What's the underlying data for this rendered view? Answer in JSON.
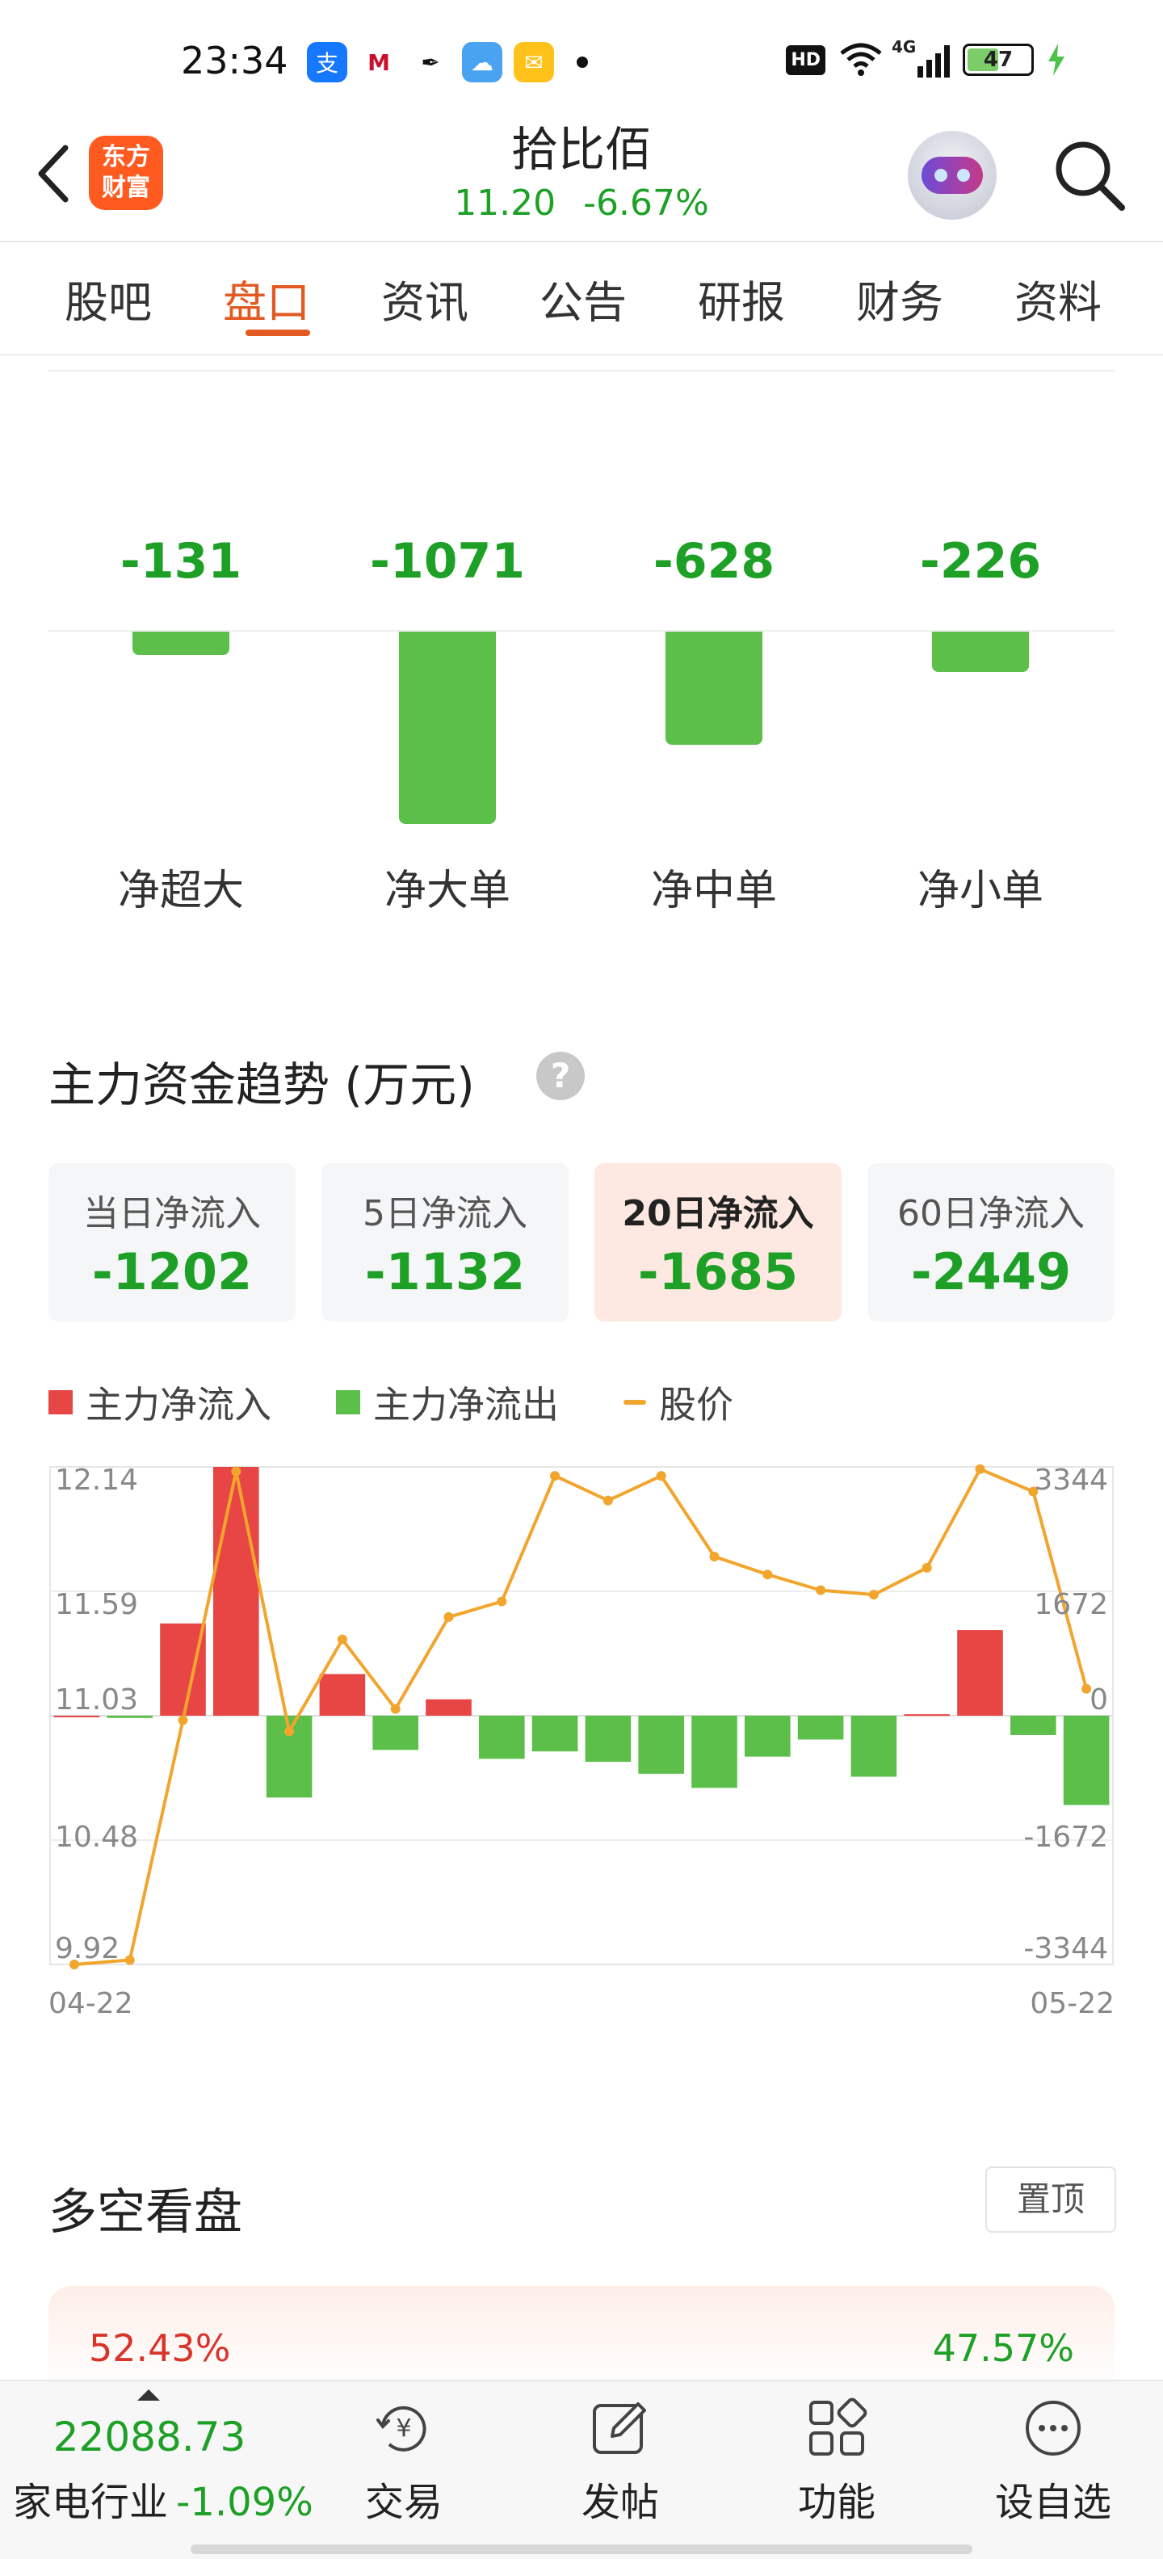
{
  "status_bar": {
    "time": "23:34",
    "network": "4G",
    "hd": "HD",
    "battery": "47"
  },
  "header": {
    "logo_line1": "东方",
    "logo_line2": "财富",
    "stock_name": "拾比佰",
    "price": "11.20",
    "change_pct": "-6.67%"
  },
  "tabs": [
    {
      "label": "股吧",
      "active": false
    },
    {
      "label": "盘口",
      "active": true
    },
    {
      "label": "资讯",
      "active": false
    },
    {
      "label": "公告",
      "active": false
    },
    {
      "label": "研报",
      "active": false
    },
    {
      "label": "财务",
      "active": false
    },
    {
      "label": "资料",
      "active": false
    }
  ],
  "net_flow": [
    {
      "label": "净超大",
      "value": -131
    },
    {
      "label": "净大单",
      "value": -1071
    },
    {
      "label": "净中单",
      "value": -628
    },
    {
      "label": "净小单",
      "value": -226
    }
  ],
  "trend": {
    "title": "主力资金趋势 (万元)",
    "help": "?",
    "cards": [
      {
        "label": "当日净流入",
        "value": "-1202",
        "active": false
      },
      {
        "label": "5日净流入",
        "value": "-1132",
        "active": false
      },
      {
        "label": "20日净流入",
        "value": "-1685",
        "active": true
      },
      {
        "label": "60日净流入",
        "value": "-2449",
        "active": false
      }
    ],
    "legend": {
      "inflow": "主力净流入",
      "outflow": "主力净流出",
      "price": "股价"
    }
  },
  "colors": {
    "inflow": "#e84545",
    "outflow": "#5bbf4a",
    "price": "#f2a52d",
    "accent": "#e25a22",
    "down_green": "#1ea027"
  },
  "chart_data": {
    "type": "bar",
    "x_start_label": "04-22",
    "x_end_label": "05-22",
    "left_ticks": [
      "12.14",
      "11.59",
      "11.03",
      "10.48",
      "9.92"
    ],
    "right_ticks": [
      "3344",
      "1672",
      "0",
      "-1672",
      "-3344"
    ],
    "price_range": [
      9.92,
      12.14
    ],
    "flow_range": [
      -3344,
      3344
    ],
    "series": [
      {
        "kind": "flow",
        "values": [
          0,
          -30,
          1240,
          3344,
          -1100,
          560,
          -460,
          220,
          -580,
          -480,
          -620,
          -780,
          -970,
          -550,
          -320,
          -820,
          20,
          1150,
          -260,
          -1200
        ]
      },
      {
        "kind": "price",
        "values": [
          9.92,
          9.94,
          11.01,
          12.12,
          10.96,
          11.37,
          11.06,
          11.47,
          11.54,
          12.1,
          11.99,
          12.1,
          11.74,
          11.66,
          11.59,
          11.57,
          11.69,
          12.13,
          12.03,
          11.15
        ]
      }
    ]
  },
  "bull_bear": {
    "title": "多空看盘",
    "pin_label": "置顶",
    "bull_pct": "52.43%",
    "bear_pct": "47.57%"
  },
  "bottom_nav": {
    "industry_index": "22088.73",
    "industry_name": "家电行业",
    "industry_change": "-1.09%",
    "items": [
      {
        "label": "交易",
        "icon": "trade-icon"
      },
      {
        "label": "发帖",
        "icon": "edit-icon"
      },
      {
        "label": "功能",
        "icon": "grid-icon"
      },
      {
        "label": "设自选",
        "icon": "more-icon"
      }
    ]
  }
}
